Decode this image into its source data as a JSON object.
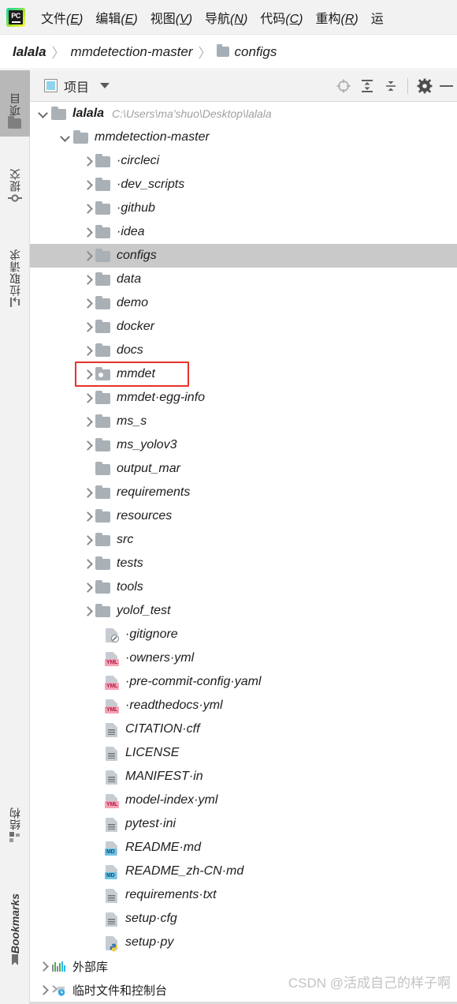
{
  "menu": {
    "logo_text": "PC",
    "items": [
      {
        "label": "文件",
        "accel": "E"
      },
      {
        "label": "编辑",
        "accel": "E"
      },
      {
        "label": "视图",
        "accel": "V"
      },
      {
        "label": "导航",
        "accel": "N"
      },
      {
        "label": "代码",
        "accel": "C"
      },
      {
        "label": "重构",
        "accel": "R"
      },
      {
        "label": "运",
        "accel": ""
      }
    ]
  },
  "breadcrumb": {
    "items": [
      "lalala",
      "mmdetection-master",
      "configs"
    ],
    "separator": "〉"
  },
  "toolstrip": {
    "top": [
      {
        "label": "项目",
        "icon": "folder-icon",
        "active": true
      },
      {
        "label": "提交",
        "icon": "commit-icon",
        "active": false
      },
      {
        "label": "拉取请求",
        "icon": "pull-request-icon",
        "active": false
      }
    ],
    "bottom": [
      {
        "label": "结构",
        "icon": "structure-icon",
        "active": false
      },
      {
        "label": "Bookmarks",
        "icon": "bookmark-icon",
        "active": false
      }
    ]
  },
  "panel": {
    "title": "项目",
    "icon": "project-icon",
    "caret": "chevron-down-icon",
    "tools": [
      "locate-icon",
      "expand-all-icon",
      "collapse-all-icon",
      "settings-gear-icon",
      "minimize-icon"
    ]
  },
  "tree": {
    "root": {
      "name": "lalala",
      "path": "C:\\Users\\ma'shuo\\Desktop\\lalala"
    },
    "project": "mmdetection-master",
    "items": [
      {
        "name": "·circleci",
        "type": "folder",
        "arrow": "right",
        "indent": 2
      },
      {
        "name": "·dev_scripts",
        "type": "folder",
        "arrow": "right",
        "indent": 2
      },
      {
        "name": "·github",
        "type": "folder",
        "arrow": "right",
        "indent": 2
      },
      {
        "name": "·idea",
        "type": "folder",
        "arrow": "right",
        "indent": 2
      },
      {
        "name": "configs",
        "type": "folder",
        "arrow": "right",
        "indent": 2,
        "selected": true
      },
      {
        "name": "data",
        "type": "folder",
        "arrow": "right",
        "indent": 2
      },
      {
        "name": "demo",
        "type": "folder",
        "arrow": "right",
        "indent": 2
      },
      {
        "name": "docker",
        "type": "folder",
        "arrow": "right",
        "indent": 2
      },
      {
        "name": "docs",
        "type": "folder",
        "arrow": "right",
        "indent": 2
      },
      {
        "name": "mmdet",
        "type": "package",
        "arrow": "right",
        "indent": 2,
        "highlight": true
      },
      {
        "name": "mmdet·egg-info",
        "type": "folder",
        "arrow": "right",
        "indent": 2
      },
      {
        "name": "ms_s",
        "type": "folder",
        "arrow": "right",
        "indent": 2
      },
      {
        "name": "ms_yolov3",
        "type": "folder",
        "arrow": "right",
        "indent": 2
      },
      {
        "name": "output_mar",
        "type": "folder",
        "arrow": "none",
        "indent": 2
      },
      {
        "name": "requirements",
        "type": "folder",
        "arrow": "right",
        "indent": 2
      },
      {
        "name": "resources",
        "type": "folder",
        "arrow": "right",
        "indent": 2
      },
      {
        "name": "src",
        "type": "folder",
        "arrow": "right",
        "indent": 2
      },
      {
        "name": "tests",
        "type": "folder",
        "arrow": "right",
        "indent": 2
      },
      {
        "name": "tools",
        "type": "folder",
        "arrow": "right",
        "indent": 2
      },
      {
        "name": "yolof_test",
        "type": "folder",
        "arrow": "right",
        "indent": 2
      },
      {
        "name": "·gitignore",
        "type": "file-git",
        "arrow": "none",
        "indent": 2
      },
      {
        "name": "·owners·yml",
        "type": "file-yml",
        "arrow": "none",
        "indent": 2,
        "badge": "YML"
      },
      {
        "name": "·pre-commit-config·yaml",
        "type": "file-yml",
        "arrow": "none",
        "indent": 2,
        "badge": "YML"
      },
      {
        "name": "·readthedocs·yml",
        "type": "file-yml",
        "arrow": "none",
        "indent": 2,
        "badge": "YML"
      },
      {
        "name": "CITATION·cff",
        "type": "file-text",
        "arrow": "none",
        "indent": 2
      },
      {
        "name": "LICENSE",
        "type": "file-text",
        "arrow": "none",
        "indent": 2
      },
      {
        "name": "MANIFEST·in",
        "type": "file-text",
        "arrow": "none",
        "indent": 2
      },
      {
        "name": "model-index·yml",
        "type": "file-yml",
        "arrow": "none",
        "indent": 2,
        "badge": "YML"
      },
      {
        "name": "pytest·ini",
        "type": "file-text",
        "arrow": "none",
        "indent": 2
      },
      {
        "name": "README·md",
        "type": "file-md",
        "arrow": "none",
        "indent": 2,
        "badge": "MD"
      },
      {
        "name": "README_zh-CN·md",
        "type": "file-md",
        "arrow": "none",
        "indent": 2,
        "badge": "MD"
      },
      {
        "name": "requirements·txt",
        "type": "file-text",
        "arrow": "none",
        "indent": 2
      },
      {
        "name": "setup·cfg",
        "type": "file-text",
        "arrow": "none",
        "indent": 2
      },
      {
        "name": "setup·py",
        "type": "file-py",
        "arrow": "none",
        "indent": 2
      }
    ],
    "footer": [
      {
        "name": "外部库",
        "icon": "external-libraries-icon",
        "arrow": "right"
      },
      {
        "name": "临时文件和控制台",
        "icon": "scratches-consoles-icon",
        "arrow": "right"
      }
    ]
  },
  "watermark": "CSDN @活成自己的样子啊",
  "colors": {
    "selection": "#c9c9c9",
    "highlight_box": "#e8322a",
    "folder": "#a9b0b6",
    "yml_badge": "#f5a3b5",
    "md_badge": "#6cc4e8",
    "accent_blue": "#8fd4ee"
  }
}
